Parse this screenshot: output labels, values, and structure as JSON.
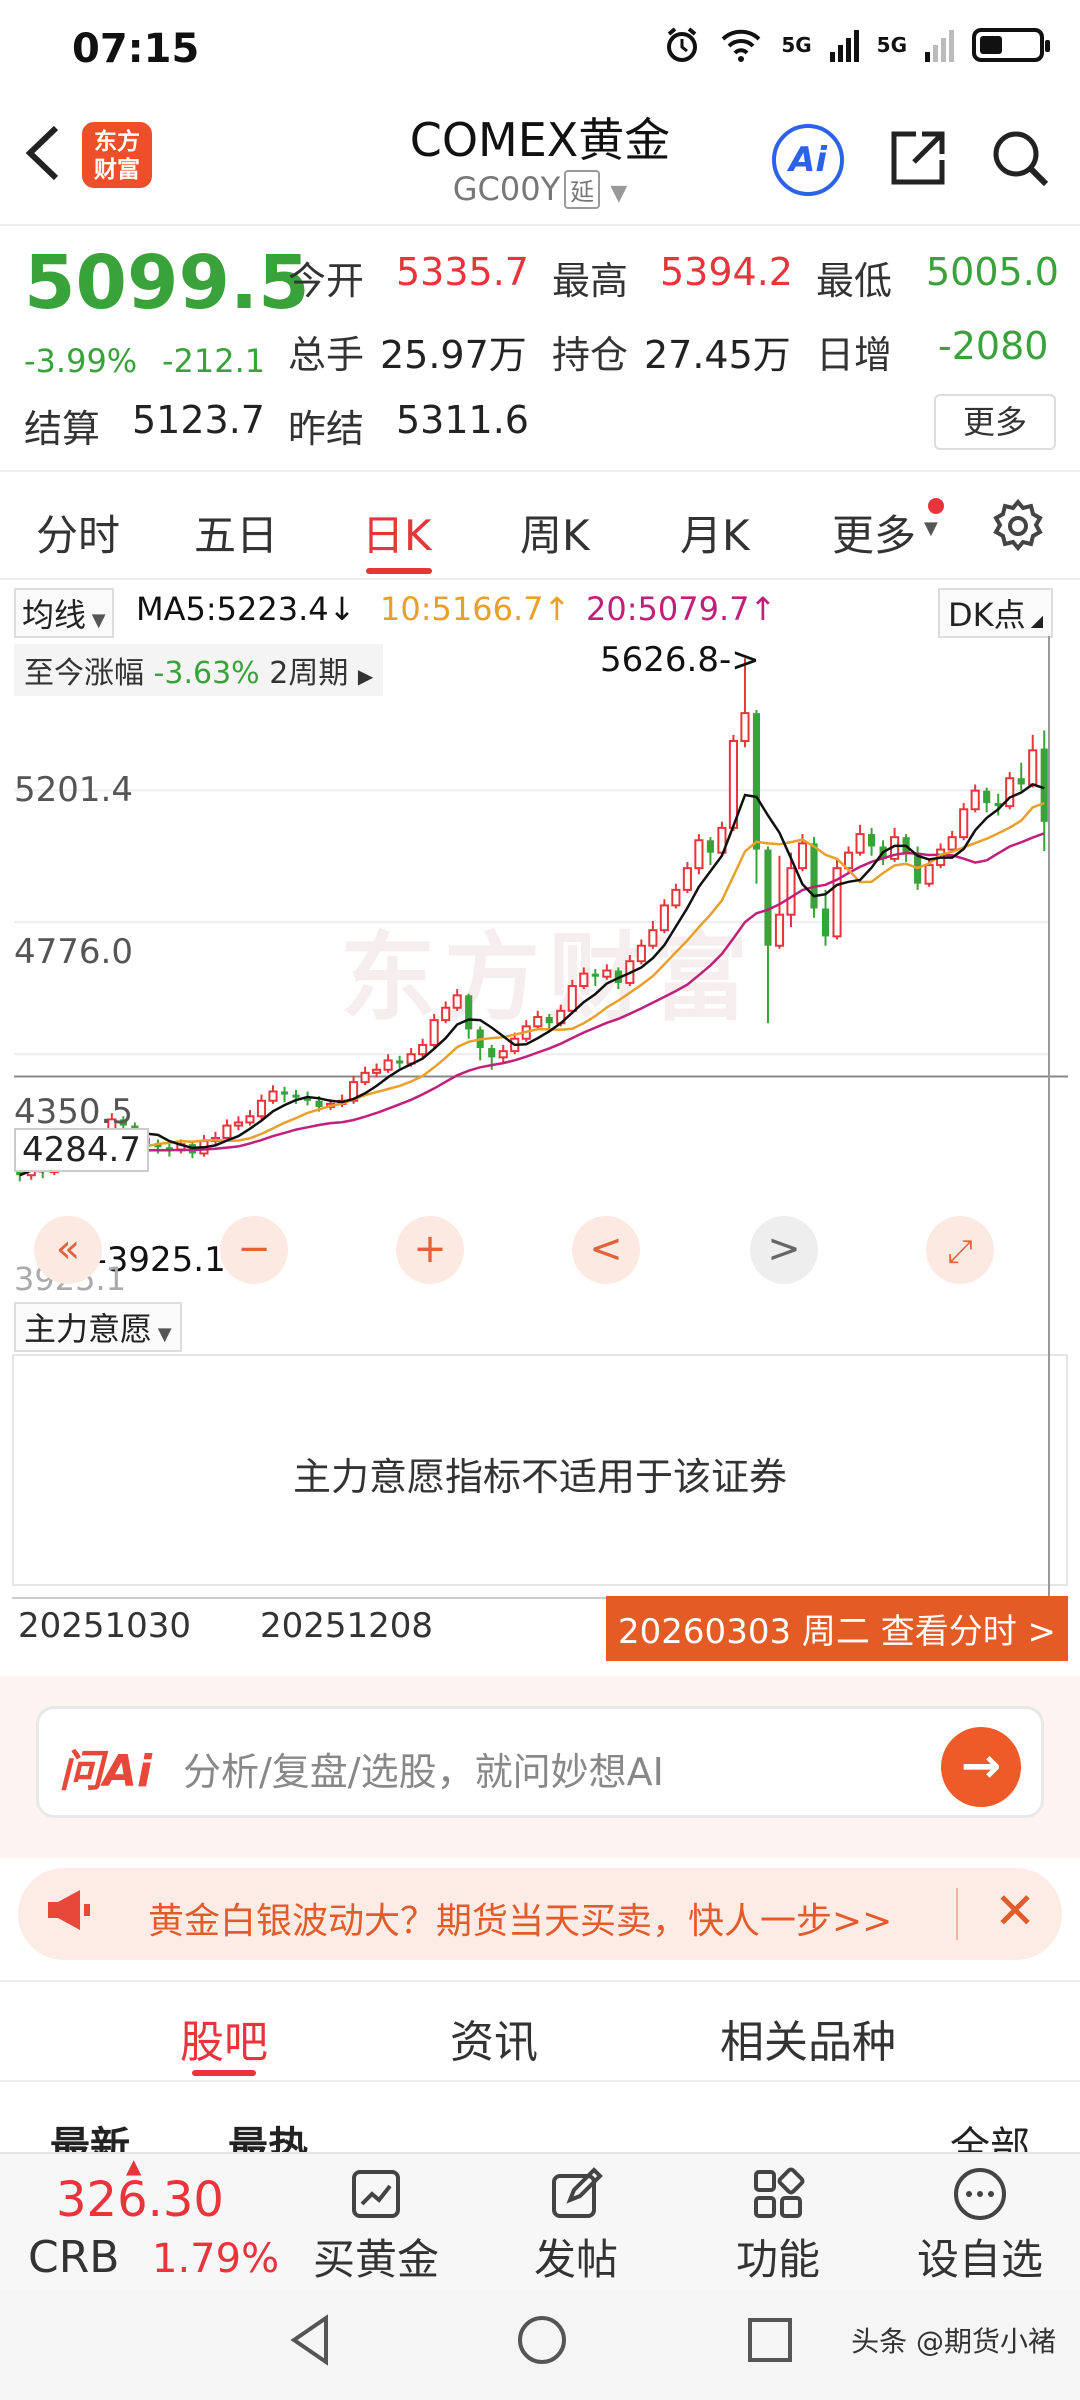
{
  "status": {
    "time": "07:15",
    "net1": "5G",
    "net2": "5G"
  },
  "header": {
    "logo_line1": "东方",
    "logo_line2": "财富",
    "title": "COMEX黄金",
    "code": "GC00Y",
    "code_tag": "延",
    "ai_label": "Ai"
  },
  "quote": {
    "last": "5099.5",
    "pct": "-3.99%",
    "chg": "-212.1",
    "open_label": "今开",
    "open": "5335.7",
    "high_label": "最高",
    "high": "5394.2",
    "low_label": "最低",
    "low": "5005.0",
    "vol_label": "总手",
    "vol": "25.97万",
    "oi_label": "持仓",
    "oi": "27.45万",
    "inc_label": "日增",
    "inc": "-2080",
    "settle_label": "结算",
    "settle": "5123.7",
    "prev_label": "昨结",
    "prev": "5311.6",
    "more_label": "更多"
  },
  "period_tabs": [
    "分时",
    "五日",
    "日K",
    "周K",
    "月K",
    "更多"
  ],
  "ma": {
    "selector": "均线",
    "ma5": "MA5:5223.4",
    "ma10": "10:5166.7",
    "ma20": "20:5079.7",
    "dk_label": "DK点"
  },
  "chart": {
    "range_label": "至今涨幅",
    "range_value": "-3.63%",
    "range_period": "2周期",
    "y_labels": [
      "5201.4",
      "4776.0",
      "4350.5"
    ],
    "peak_label": "5626.8->",
    "low_label": "<-3925.1",
    "marker_label": "4284.7",
    "bottom_label": "3925.1",
    "watermark": "东方财富",
    "colors": {
      "up": "#e8343a",
      "down": "#3aa23a",
      "ma5": "#111111",
      "ma10": "#e8a02a",
      "ma20": "#c0207a"
    }
  },
  "chart_data": {
    "type": "candlestick",
    "series": [
      {
        "name": "MA5",
        "value": 5223.4
      },
      {
        "name": "MA10",
        "value": 5166.7
      },
      {
        "name": "MA20",
        "value": 5079.7
      }
    ],
    "ylim": [
      3925.1,
      5626.8
    ],
    "candles": [
      [
        3980,
        3960,
        4010,
        3940
      ],
      [
        3960,
        3990,
        4010,
        3945
      ],
      [
        3990,
        3970,
        4000,
        3950
      ],
      [
        3970,
        4010,
        4030,
        3960
      ],
      [
        4010,
        4000,
        4030,
        3985
      ],
      [
        4000,
        4050,
        4070,
        3995
      ],
      [
        4050,
        4030,
        4060,
        4010
      ],
      [
        4030,
        4070,
        4090,
        4020
      ],
      [
        4070,
        4140,
        4160,
        4060
      ],
      [
        4140,
        4120,
        4150,
        4080
      ],
      [
        4120,
        4080,
        4130,
        4040
      ],
      [
        4080,
        4060,
        4090,
        4030
      ],
      [
        4060,
        4050,
        4075,
        4030
      ],
      [
        4050,
        4040,
        4065,
        4020
      ],
      [
        4040,
        4060,
        4075,
        4030
      ],
      [
        4060,
        4030,
        4070,
        4015
      ],
      [
        4030,
        4070,
        4090,
        4020
      ],
      [
        4070,
        4080,
        4100,
        4055
      ],
      [
        4080,
        4120,
        4140,
        4070
      ],
      [
        4120,
        4130,
        4150,
        4105
      ],
      [
        4130,
        4150,
        4170,
        4120
      ],
      [
        4150,
        4200,
        4220,
        4140
      ],
      [
        4200,
        4230,
        4250,
        4190
      ],
      [
        4230,
        4220,
        4245,
        4195
      ],
      [
        4220,
        4210,
        4235,
        4190
      ],
      [
        4210,
        4200,
        4230,
        4185
      ],
      [
        4200,
        4180,
        4215,
        4165
      ],
      [
        4180,
        4190,
        4205,
        4170
      ],
      [
        4190,
        4200,
        4220,
        4180
      ],
      [
        4200,
        4260,
        4280,
        4190
      ],
      [
        4260,
        4290,
        4310,
        4250
      ],
      [
        4290,
        4300,
        4320,
        4275
      ],
      [
        4300,
        4330,
        4350,
        4290
      ],
      [
        4330,
        4320,
        4345,
        4305
      ],
      [
        4320,
        4350,
        4370,
        4310
      ],
      [
        4350,
        4380,
        4400,
        4340
      ],
      [
        4380,
        4460,
        4480,
        4370
      ],
      [
        4460,
        4500,
        4520,
        4450
      ],
      [
        4500,
        4540,
        4560,
        4490
      ],
      [
        4540,
        4430,
        4545,
        4400
      ],
      [
        4430,
        4370,
        4440,
        4330
      ],
      [
        4370,
        4340,
        4380,
        4300
      ],
      [
        4340,
        4360,
        4380,
        4320
      ],
      [
        4360,
        4400,
        4420,
        4350
      ],
      [
        4400,
        4440,
        4460,
        4390
      ],
      [
        4440,
        4470,
        4490,
        4430
      ],
      [
        4470,
        4450,
        4480,
        4420
      ],
      [
        4450,
        4490,
        4510,
        4440
      ],
      [
        4490,
        4570,
        4590,
        4480
      ],
      [
        4570,
        4610,
        4630,
        4560
      ],
      [
        4610,
        4600,
        4625,
        4570
      ],
      [
        4600,
        4620,
        4640,
        4590
      ],
      [
        4620,
        4580,
        4630,
        4560
      ],
      [
        4580,
        4650,
        4670,
        4570
      ],
      [
        4650,
        4700,
        4720,
        4640
      ],
      [
        4700,
        4750,
        4780,
        4690
      ],
      [
        4750,
        4830,
        4850,
        4740
      ],
      [
        4830,
        4880,
        4900,
        4820
      ],
      [
        4880,
        4950,
        4970,
        4870
      ],
      [
        4950,
        5040,
        5060,
        4930
      ],
      [
        5040,
        5000,
        5050,
        4960
      ],
      [
        5000,
        5080,
        5100,
        4990
      ],
      [
        5080,
        5360,
        5380,
        5070
      ],
      [
        5360,
        5450,
        5626.8,
        5340
      ],
      [
        5450,
        5010,
        5460,
        4900
      ],
      [
        5010,
        4700,
        5020,
        4450
      ],
      [
        4700,
        4800,
        4990,
        4690
      ],
      [
        4800,
        4950,
        5000,
        4760
      ],
      [
        4950,
        5030,
        5060,
        4940
      ],
      [
        5030,
        4820,
        5050,
        4790
      ],
      [
        4820,
        4730,
        4880,
        4700
      ],
      [
        4730,
        4950,
        4980,
        4720
      ],
      [
        4950,
        5000,
        5020,
        4930
      ],
      [
        5000,
        5060,
        5090,
        4990
      ],
      [
        5060,
        5020,
        5080,
        4990
      ],
      [
        5020,
        4980,
        5040,
        4960
      ],
      [
        4980,
        5050,
        5080,
        4970
      ],
      [
        5050,
        5000,
        5060,
        4970
      ],
      [
        5000,
        4900,
        5020,
        4880
      ],
      [
        4900,
        4960,
        4980,
        4890
      ],
      [
        4960,
        5010,
        5030,
        4950
      ],
      [
        5010,
        5050,
        5070,
        5000
      ],
      [
        5050,
        5140,
        5160,
        5040
      ],
      [
        5140,
        5200,
        5220,
        5130
      ],
      [
        5200,
        5160,
        5210,
        5130
      ],
      [
        5160,
        5150,
        5190,
        5120
      ],
      [
        5150,
        5240,
        5260,
        5140
      ],
      [
        5240,
        5220,
        5290,
        5200
      ],
      [
        5220,
        5330,
        5380,
        5210
      ],
      [
        5335.7,
        5099.5,
        5394.2,
        5005.0
      ]
    ]
  },
  "controls": {
    "zoom_in": "+",
    "prev": "<",
    "next": ">"
  },
  "indicator": {
    "selector": "主力意愿",
    "message": "主力意愿指标不适用于该证券"
  },
  "dates": {
    "left": "20251030",
    "mid": "20251208",
    "selected": "20260303 周二 查看分时 >"
  },
  "ask_ai": {
    "logo": "问Ai",
    "placeholder": "分析/复盘/选股，就问妙想AI"
  },
  "banner": {
    "text": "黄金白银波动大？期货当天买卖，快人一步>>"
  },
  "content_tabs": [
    "股吧",
    "资讯",
    "相关品种"
  ],
  "sort": {
    "latest": "最新",
    "hot": "最热",
    "filter": "全部"
  },
  "bottom_bar": {
    "crb_value": "326.30",
    "crb_name": "CRB",
    "crb_pct": "1.79%",
    "items": [
      "买黄金",
      "发帖",
      "功能",
      "设自选"
    ]
  },
  "watermark_caption": "头条 @期货小褚"
}
